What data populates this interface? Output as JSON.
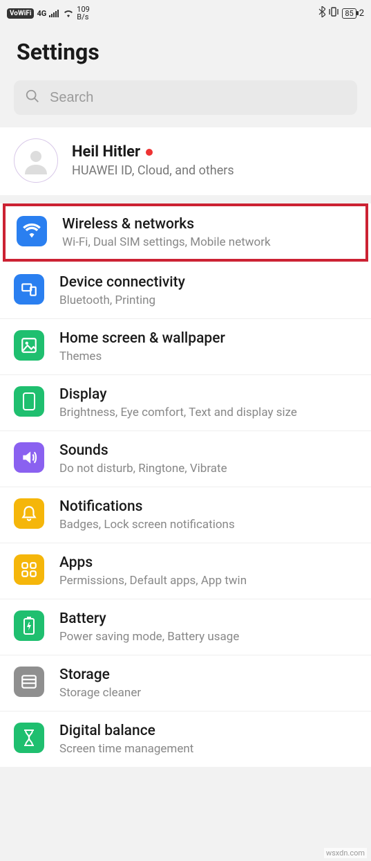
{
  "status": {
    "vowifi": "VoWiFi",
    "fourg": "4G",
    "rate_top": "109",
    "rate_bottom": "B/s",
    "battery": "85",
    "right_extra": "2"
  },
  "header": {
    "title": "Settings"
  },
  "search": {
    "placeholder": "Search"
  },
  "account": {
    "name": "Heil Hitler",
    "subtitle": "HUAWEI ID, Cloud, and others"
  },
  "items": [
    {
      "title": "Wireless & networks",
      "desc": "Wi-Fi, Dual SIM settings, Mobile network",
      "color": "#2a7ff0",
      "highlight": true
    },
    {
      "title": "Device connectivity",
      "desc": "Bluetooth, Printing",
      "color": "#2a7ff0"
    },
    {
      "title": "Home screen & wallpaper",
      "desc": "Themes",
      "color": "#1fbf6f"
    },
    {
      "title": "Display",
      "desc": "Brightness, Eye comfort, Text and display size",
      "color": "#1fbf6f"
    },
    {
      "title": "Sounds",
      "desc": "Do not disturb, Ringtone, Vibrate",
      "color": "#8a61f0"
    },
    {
      "title": "Notifications",
      "desc": "Badges, Lock screen notifications",
      "color": "#f5b60a"
    },
    {
      "title": "Apps",
      "desc": "Permissions, Default apps, App twin",
      "color": "#f5b60a"
    },
    {
      "title": "Battery",
      "desc": "Power saving mode, Battery usage",
      "color": "#1fbf6f"
    },
    {
      "title": "Storage",
      "desc": "Storage cleaner",
      "color": "#8f8f8f"
    },
    {
      "title": "Digital balance",
      "desc": "Screen time management",
      "color": "#1fbf6f"
    }
  ],
  "watermark": "wsxdn.com"
}
